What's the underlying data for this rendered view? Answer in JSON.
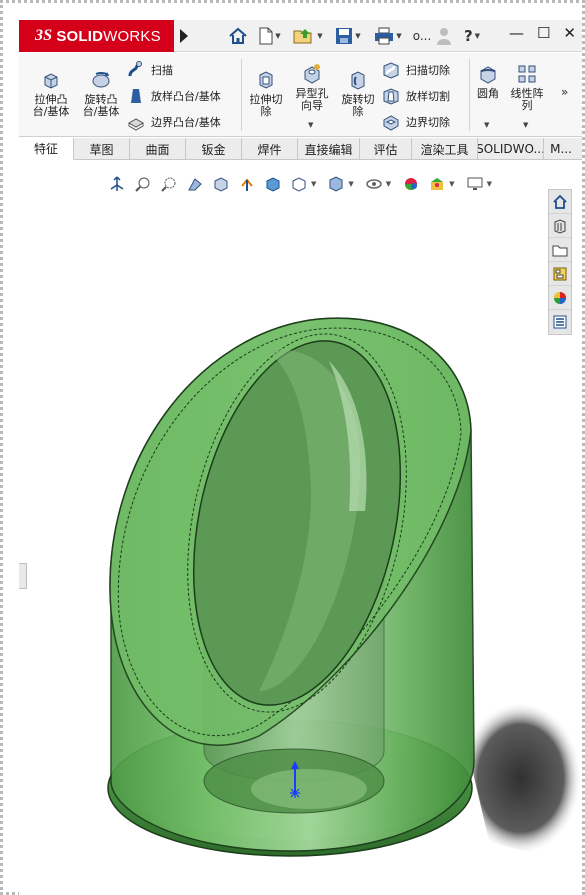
{
  "app": {
    "brand_prefix": "3S",
    "brand_bold": "SOLID",
    "brand_light": "WORKS",
    "user_label": "o..."
  },
  "ribbon": {
    "extrude_boss": "拉伸凸\n台/基体",
    "revolve_boss": "旋转凸\n台/基体",
    "sweep": "扫描",
    "loft_boss": "放样凸台/基体",
    "boundary_boss": "边界凸台/基体",
    "extrude_cut": "拉伸切\n除",
    "hole_wizard": "异型孔\n向导",
    "revolve_cut": "旋转切\n除",
    "swept_cut": "扫描切除",
    "lofted_cut": "放样切割",
    "boundary_cut": "边界切除",
    "fillet": "圆角",
    "linear_pattern": "线性阵\n列"
  },
  "tabs": [
    {
      "label": "特征"
    },
    {
      "label": "草图"
    },
    {
      "label": "曲面"
    },
    {
      "label": "钣金"
    },
    {
      "label": "焊件"
    },
    {
      "label": "直接编辑"
    },
    {
      "label": "评估"
    },
    {
      "label": "渲染工具"
    },
    {
      "label": "SOLIDWO..."
    },
    {
      "label": "M..."
    }
  ],
  "colors": {
    "brand_red": "#d4001a",
    "model_green": "#5fae55",
    "model_dark": "#2d6b2a",
    "triad_blue": "#1a3cff"
  }
}
